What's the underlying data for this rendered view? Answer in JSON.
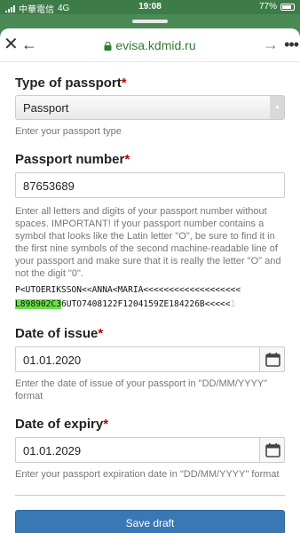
{
  "status_bar": {
    "carrier": "中華電信",
    "network": "4G",
    "time": "19:08",
    "battery": "77%"
  },
  "browser": {
    "url": "evisa.kdmid.ru"
  },
  "form": {
    "passport_type": {
      "label": "Type of passport",
      "required_mark": "*",
      "selected": "Passport",
      "help": "Enter your passport type"
    },
    "passport_number": {
      "label": "Passport number",
      "required_mark": "*",
      "value": "87653689",
      "help": "Enter all letters and digits of your passport number without spaces. IMPORTANT! If your passport number contains a symbol that looks like the Latin letter \"O\", be sure to find it in the first nine symbols of the second machine-readable line of your passport and make sure that it is really the letter \"O\" and not the digit \"0\"."
    },
    "mrz": {
      "line1": "P<UTOERIKSSON<<ANNA<MARIA<<<<<<<<<<<<<<<<<<<",
      "line2_highlight": "L898902C3",
      "line2_rest": "6UTO7408122F1204159ZE184226B<<<<<",
      "line2_tail": "1"
    },
    "date_of_issue": {
      "label": "Date of issue",
      "required_mark": "*",
      "value": "01.01.2020",
      "help": "Enter the date of issue of your passport in \"DD/MM/YYYY\" format"
    },
    "date_of_expiry": {
      "label": "Date of expiry",
      "required_mark": "*",
      "value": "01.01.2029",
      "help": "Enter your passport expiration date in \"DD/MM/YYYY\" format"
    },
    "save_label": "Save draft"
  },
  "colors": {
    "url_green": "#2e7d32",
    "save_blue": "#3a77b5",
    "highlight_green": "#6be04a",
    "required_red": "#bb0000"
  },
  "icons": {
    "close": "close-icon",
    "back": "back-arrow-icon",
    "forward": "forward-arrow-icon",
    "more": "more-dots-icon",
    "lock": "lock-icon",
    "calendar": "calendar-icon"
  }
}
